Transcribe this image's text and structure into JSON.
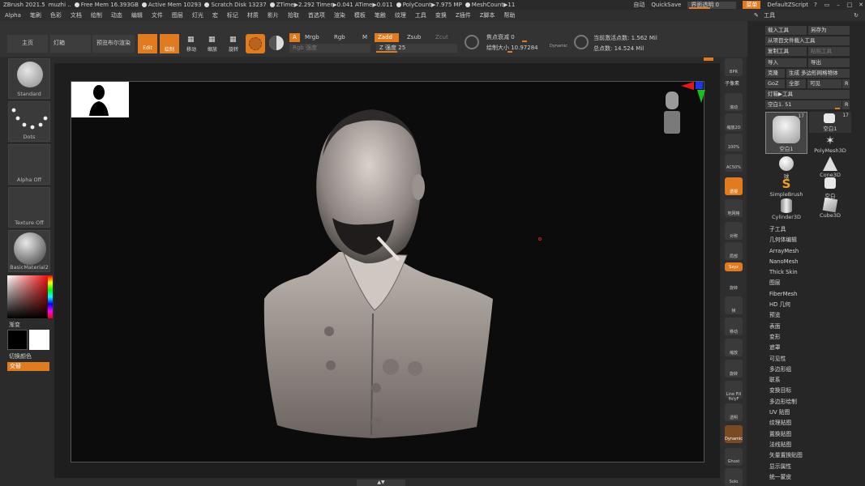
{
  "titlebar": {
    "app": "ZBrush 2021.5",
    "user": "muzhi ..",
    "free_mem": "Free Mem 16.393GB",
    "active_mem": "Active Mem 10293",
    "scratch": "Scratch Disk 13237",
    "ztime": "ZTime▶2.292 Timer▶0.041 ATime▶0.011",
    "polycount": "PolyCount▶7.975 MP",
    "meshcount": "MeshCount▶11",
    "auto": "自动",
    "quicksave": "QuickSave",
    "transparency": "界面透明 0",
    "menu": "菜单",
    "script": "DefaultZScript"
  },
  "menubar": [
    "Alpha",
    "笔刷",
    "色彩",
    "文档",
    "绘制",
    "动态",
    "编辑",
    "文件",
    "图层",
    "灯光",
    "宏",
    "标记",
    "材质",
    "影片",
    "拾取",
    "首选项",
    "渲染",
    "模板",
    "笔触",
    "纹理",
    "工具",
    "变换",
    "Z插件",
    "Z脚本",
    "帮助"
  ],
  "toolbar": {
    "home": "主页",
    "lightbox": "灯箱",
    "bpr": "预览布尔渲染",
    "edit": "Edit",
    "draw": "绘制",
    "move": "移动",
    "scale": "缩放",
    "rotate": "旋转",
    "a": "A",
    "mrgb": "Mrgb",
    "rgb": "Rgb",
    "m": "M",
    "zadd": "Zadd",
    "zsub": "Zsub",
    "zcut": "Zcut",
    "rgb_intensity": "Rgb 强度",
    "z_intensity": "Z 强度 25",
    "focal": "焦点衰减 0",
    "draw_size": "绘制大小 10.97284",
    "dynamic": "Dynamic",
    "active_points": "当前激活点数: 1.562 Mil",
    "total_points": "总点数: 14.524 Mil"
  },
  "leftshelf": {
    "brush": "Standard",
    "stroke": "Dots",
    "alpha": "Alpha Off",
    "texture": "Texture Off",
    "material": "BasicMaterial2",
    "gradient": "渐变",
    "switch": "切换颜色",
    "alternate": "交替"
  },
  "rightshelf": [
    "BPR",
    "子像素",
    "滚动",
    "缩放2D",
    "100%",
    "AC50%",
    "透视",
    "地网格",
    "对称",
    "局部",
    "Sxyz",
    "旋转",
    "帧",
    "移动",
    "缩放",
    "旋转",
    "Line Fill PolyF",
    "透明",
    "Dynamic",
    "Ghost",
    "Solo"
  ],
  "palette": {
    "title": "工具",
    "load": "载入工具",
    "save_as": "另存为",
    "load_project": "从项目文件载入工具",
    "copy": "复制工具",
    "paste": "粘贴工具",
    "import": "导入",
    "export": "导出",
    "clone": "克隆",
    "make_polymesh": "生成 多边形网格物体",
    "goz": "GoZ",
    "all": "全部",
    "visible": "可见",
    "r": "R",
    "lightbox_tools": "灯箱▶工具",
    "current": "空白1. 51",
    "count1": "17",
    "count2": "17",
    "thumbs": [
      "空白1",
      "空白1",
      "PolyMesh3D",
      "球",
      "Cone3D",
      "SimpleBrush",
      "空白",
      "Cylinder3D",
      "Cube3D"
    ],
    "subpalettes": [
      "子工具",
      "几何体编辑",
      "ArrayMesh",
      "NanoMesh",
      "Thick Skin",
      "图层",
      "FiberMesh",
      "HD 几何",
      "预览",
      "表面",
      "变形",
      "遮罩",
      "可见性",
      "多边形组",
      "联系",
      "变换目标",
      "多边形绘制",
      "UV 贴图",
      "纹理贴图",
      "置换贴图",
      "法线贴图",
      "矢量置换贴图",
      "显示属性",
      "统一蒙皮"
    ]
  },
  "colors": {
    "accent": "#e07b20",
    "background": "#2b2b2b",
    "viewport": "#0c0c0c"
  }
}
